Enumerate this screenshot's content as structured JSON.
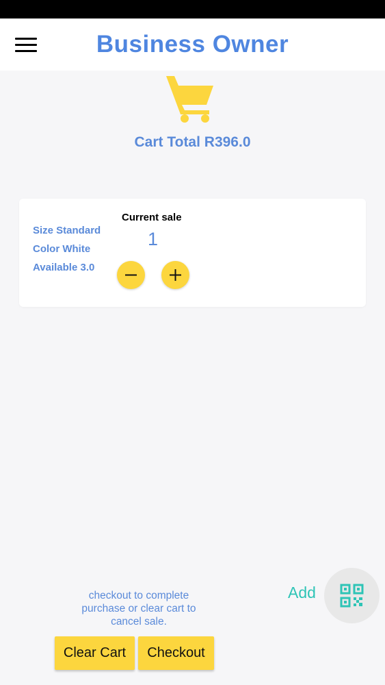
{
  "app_bar": {
    "title": "Business Owner",
    "menu_icon": "hamburger-menu-icon"
  },
  "cart": {
    "icon": "shopping-cart-icon",
    "total_text": "Cart Total R396.0"
  },
  "item_card": {
    "size": "Size Standard",
    "color": "Color White",
    "available": "Available 3.0",
    "current_sale_label": "Current sale",
    "quantity": "1",
    "decrement_icon": "minus-icon",
    "increment_icon": "plus-icon"
  },
  "footer": {
    "hint": "checkout to complete purchase or clear cart to cancel sale.",
    "add_label": "Add",
    "scan_icon": "qr-code-icon",
    "clear_cart_label": "Clear Cart",
    "checkout_label": "Checkout"
  },
  "colors": {
    "accent_blue": "#4f86e0",
    "label_blue": "#5a8ad9",
    "yellow": "#fcd63e",
    "teal": "#2ec4b6",
    "background": "#f6f6f8"
  }
}
